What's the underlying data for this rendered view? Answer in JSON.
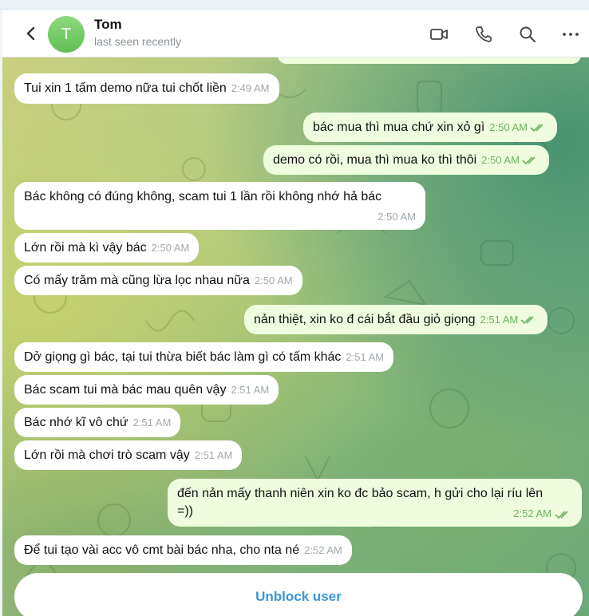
{
  "contact": {
    "avatar_letter": "T",
    "name": "Tom",
    "status": "last seen recently"
  },
  "messages": [
    {
      "text": "Tui xin 1 tấm demo nữa tui chốt liền",
      "time": "2:49 AM",
      "direction": "in"
    },
    {
      "text": "bác mua thì mua chứ xin xỏ gì",
      "time": "2:50 AM",
      "direction": "out"
    },
    {
      "text": "demo có rồi, mua thì mua ko thì thôi",
      "time": "2:50 AM",
      "direction": "out"
    },
    {
      "text": "Bác không có đúng không, scam tui 1 lần rồi không nhớ hả bác",
      "time": "2:50 AM",
      "direction": "in"
    },
    {
      "text": "Lớn rồi mà kì vậy bác",
      "time": "2:50 AM",
      "direction": "in"
    },
    {
      "text": "Có mấy trăm mà cũng lừa lọc nhau nữa",
      "time": "2:50 AM",
      "direction": "in"
    },
    {
      "text": "nản thiệt, xin ko đ cái bắt đầu giỏ giọng",
      "time": "2:51 AM",
      "direction": "out"
    },
    {
      "text": "Dở giọng gì bác, tại tui thừa biết bác làm gì có tấm khác",
      "time": "2:51 AM",
      "direction": "in"
    },
    {
      "text": "Bác scam tui mà bác mau quên vậy",
      "time": "2:51 AM",
      "direction": "in"
    },
    {
      "text": "Bác nhớ kĩ vô chứ",
      "time": "2:51 AM",
      "direction": "in"
    },
    {
      "text": "Lớn rồi mà chơi trò scam vậy",
      "time": "2:51 AM",
      "direction": "in"
    },
    {
      "text_line1": "đến nản mấy thanh niên xin ko đc bảo scam, h gửi cho lại ríu lên",
      "text_line2": "=))",
      "time": "2:52 AM",
      "direction": "out"
    },
    {
      "text": "Để tui tạo vài acc vô cmt bài bác nha, cho nta né",
      "time": "2:52 AM",
      "direction": "in"
    }
  ],
  "unblock_label": "Unblock user",
  "colors": {
    "incoming_bubble": "#ffffff",
    "outgoing_bubble": "#effdde",
    "accent": "#3a96d6",
    "outgoing_time": "#6bb35f"
  },
  "icons": [
    "back-arrow-icon",
    "video-call-icon",
    "phone-icon",
    "search-icon",
    "more-icon",
    "double-check-icon"
  ]
}
